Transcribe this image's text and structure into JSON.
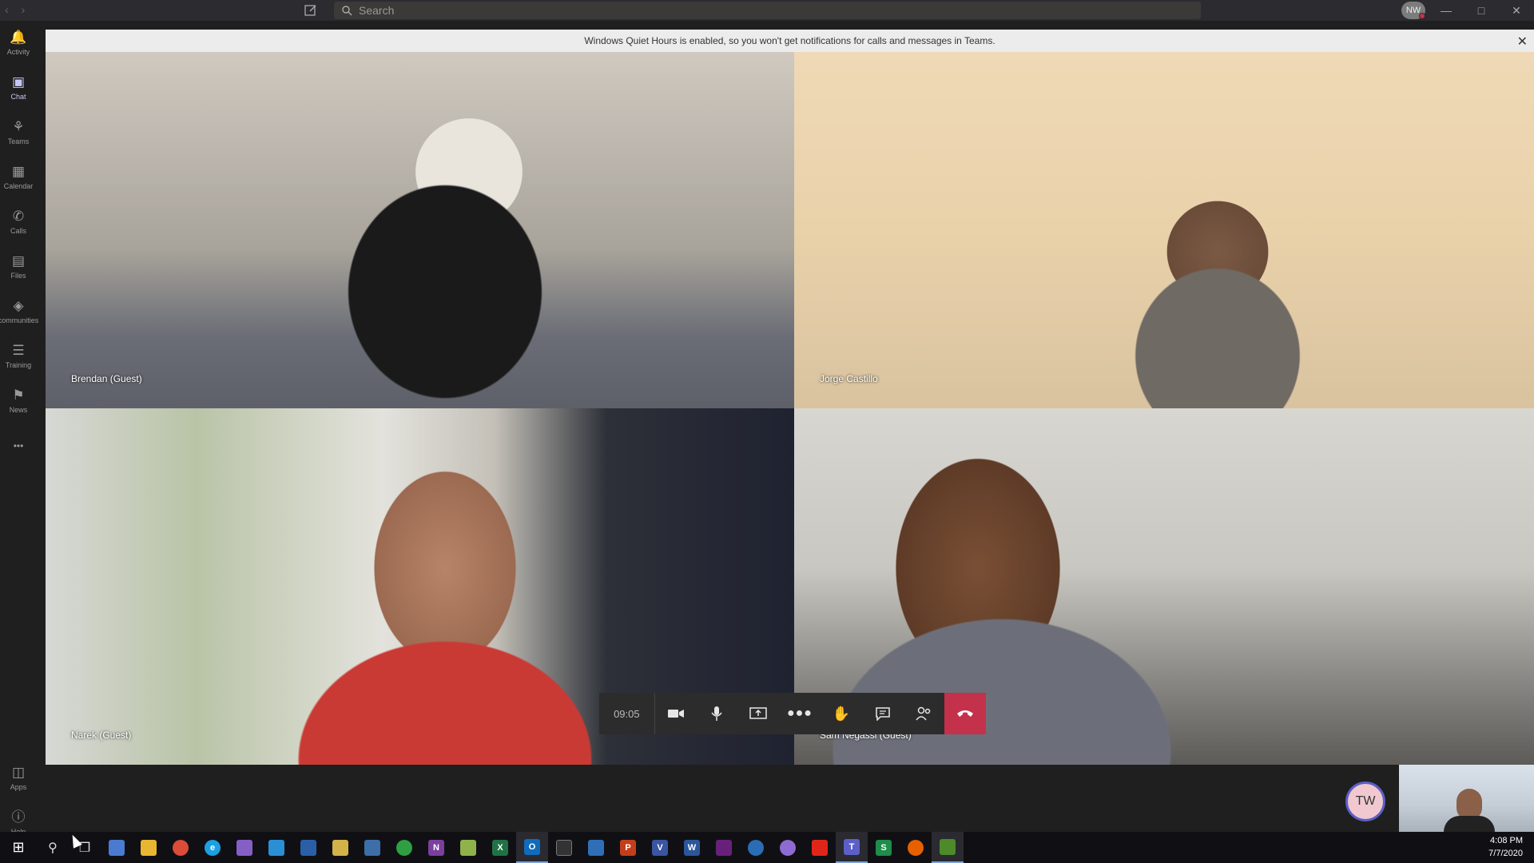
{
  "titlebar": {
    "search_placeholder": "Search",
    "user_initials": "NW"
  },
  "rail": {
    "items": [
      {
        "label": "Activity",
        "icon": "bell-icon"
      },
      {
        "label": "Chat",
        "icon": "chat-icon"
      },
      {
        "label": "Teams",
        "icon": "teams-icon"
      },
      {
        "label": "Calendar",
        "icon": "calendar-icon"
      },
      {
        "label": "Calls",
        "icon": "phone-icon"
      },
      {
        "label": "Files",
        "icon": "file-icon"
      },
      {
        "label": "communities",
        "icon": "communities-icon"
      },
      {
        "label": "Training",
        "icon": "training-icon"
      },
      {
        "label": "News",
        "icon": "news-icon"
      }
    ],
    "more": "•••",
    "apps_label": "Apps",
    "help_label": "Help"
  },
  "banner": {
    "text": "Windows Quiet Hours is enabled, so you won't get notifications for calls and messages in Teams."
  },
  "participants": [
    {
      "name": "Brendan (Guest)"
    },
    {
      "name": "Jorge Castillo"
    },
    {
      "name": "Narek (Guest)"
    },
    {
      "name": "Sam Negassi (Guest)"
    }
  ],
  "call": {
    "timer": "09:05",
    "hangup_color": "#c4314b"
  },
  "self": {
    "initials": "TW"
  },
  "taskbar": {
    "time": "4:08 PM",
    "date": "7/7/2020"
  }
}
